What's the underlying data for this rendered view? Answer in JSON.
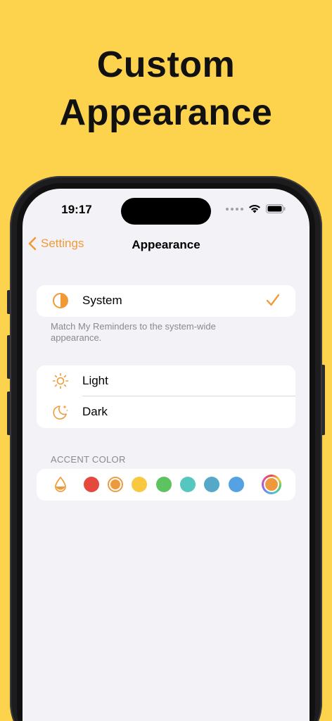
{
  "headline": {
    "line1": "Custom",
    "line2": "Appearance"
  },
  "status_bar": {
    "time": "19:17"
  },
  "nav": {
    "back_label": "Settings",
    "title": "Appearance"
  },
  "theme_options": [
    {
      "label": "System",
      "icon": "half-circle-icon",
      "selected": true
    },
    {
      "label": "Light",
      "icon": "sun-icon",
      "selected": false
    },
    {
      "label": "Dark",
      "icon": "moon-icon",
      "selected": false
    }
  ],
  "system_note": "Match My Reminders to the system-wide appearance.",
  "accent": {
    "section_title": "ACCENT COLOR",
    "colors": [
      "#E5493D",
      "#EE9A3C",
      "#F8C93F",
      "#5CC360",
      "#56C7BE",
      "#55A8C8",
      "#55A2E3"
    ],
    "selected_index": 1,
    "custom_color_icon": "color-wheel-icon",
    "accent_tint": "#F09A37"
  },
  "colors": {
    "background": "#FDD34D",
    "screen_bg": "#F2F2F7"
  }
}
